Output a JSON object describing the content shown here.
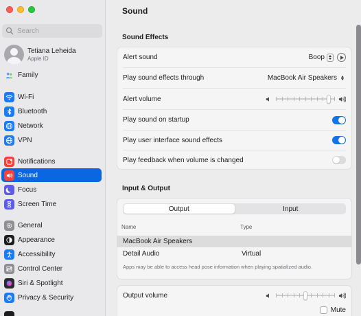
{
  "window": {
    "title": "Sound"
  },
  "search": {
    "placeholder": "Search"
  },
  "profile": {
    "name": "Tetiana Leheida",
    "subtitle": "Apple ID"
  },
  "sidebar": {
    "items": [
      {
        "label": "Family",
        "icon": "family-icon",
        "color": "#ffffff",
        "active": false
      },
      {
        "label": "Wi-Fi",
        "icon": "wifi-icon",
        "color": "#1a7cf5",
        "active": false
      },
      {
        "label": "Bluetooth",
        "icon": "bluetooth-icon",
        "color": "#1a7cf5",
        "active": false
      },
      {
        "label": "Network",
        "icon": "globe-icon",
        "color": "#1a7cf5",
        "active": false
      },
      {
        "label": "VPN",
        "icon": "vpn-globe-icon",
        "color": "#1a7cf5",
        "active": false
      },
      {
        "label": "Notifications",
        "icon": "bell-icon",
        "color": "#f2423a",
        "active": false
      },
      {
        "label": "Sound",
        "icon": "speaker-icon",
        "color": "#f2423a",
        "active": true
      },
      {
        "label": "Focus",
        "icon": "moon-icon",
        "color": "#5e5ce6",
        "active": false
      },
      {
        "label": "Screen Time",
        "icon": "hourglass-icon",
        "color": "#5e5ce6",
        "active": false
      },
      {
        "label": "General",
        "icon": "gear-icon",
        "color": "#8e8e93",
        "active": false
      },
      {
        "label": "Appearance",
        "icon": "appearance-icon",
        "color": "#1d1d1f",
        "active": false
      },
      {
        "label": "Accessibility",
        "icon": "accessibility-icon",
        "color": "#1a7cf5",
        "active": false
      },
      {
        "label": "Control Center",
        "icon": "control-center-icon",
        "color": "#8e8e93",
        "active": false
      },
      {
        "label": "Siri & Spotlight",
        "icon": "siri-icon",
        "color": "#2b2b2f",
        "active": false
      },
      {
        "label": "Privacy & Security",
        "icon": "hand-icon",
        "color": "#1a7cf5",
        "active": false
      }
    ]
  },
  "sound_effects": {
    "title": "Sound Effects",
    "alert_sound_label": "Alert sound",
    "alert_sound_value": "Boop",
    "play_through_label": "Play sound effects through",
    "play_through_value": "MacBook Air Speakers",
    "alert_volume_label": "Alert volume",
    "alert_volume_level": 0.93,
    "startup_label": "Play sound on startup",
    "startup_on": true,
    "ui_effects_label": "Play user interface sound effects",
    "ui_effects_on": true,
    "feedback_label": "Play feedback when volume is changed",
    "feedback_on": false
  },
  "io": {
    "title": "Input & Output",
    "tabs": [
      "Output",
      "Input"
    ],
    "selected_tab": "Output",
    "columns": [
      "Name",
      "Type"
    ],
    "rows": [
      {
        "name": "MacBook Air Speakers",
        "type": ""
      },
      {
        "name": "Detail Audio",
        "type": "Virtual"
      }
    ],
    "footnote": "Apps may be able to access head pose information when playing spatialized audio.",
    "output_volume_label": "Output volume",
    "output_volume_level": 0.5,
    "mute_label": "Mute"
  },
  "colors": {
    "accent": "#0a67e2",
    "toggle_on": "#1473e6"
  }
}
